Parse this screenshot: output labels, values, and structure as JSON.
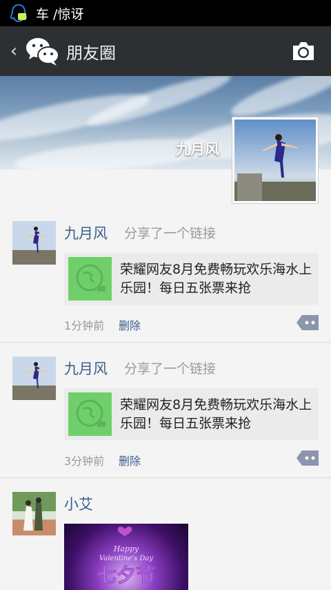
{
  "status_bar": {
    "text": "车 /惊讶"
  },
  "header": {
    "back_label": "‹",
    "title": "朋友圈"
  },
  "cover": {
    "name": "九月风"
  },
  "posts": [
    {
      "author": "九月风",
      "action": "分享了一个链接",
      "link_text": "荣耀网友8月免费畅玩欢乐海水上乐园！每日五张票来抢",
      "time": "1分钟前",
      "delete": "删除"
    },
    {
      "author": "九月风",
      "action": "分享了一个链接",
      "link_text": "荣耀网友8月免费畅玩欢乐海水上乐园！每日五张票来抢",
      "time": "3分钟前",
      "delete": "删除"
    },
    {
      "author": "小艾",
      "image_text_top": "Happy",
      "image_text_mid": "Valentine's Day",
      "image_text_cn": "七夕节"
    }
  ],
  "colors": {
    "titlebar": "#2d3033",
    "link_blue": "#3b5f8c",
    "thumb_green": "#6fd06b"
  }
}
